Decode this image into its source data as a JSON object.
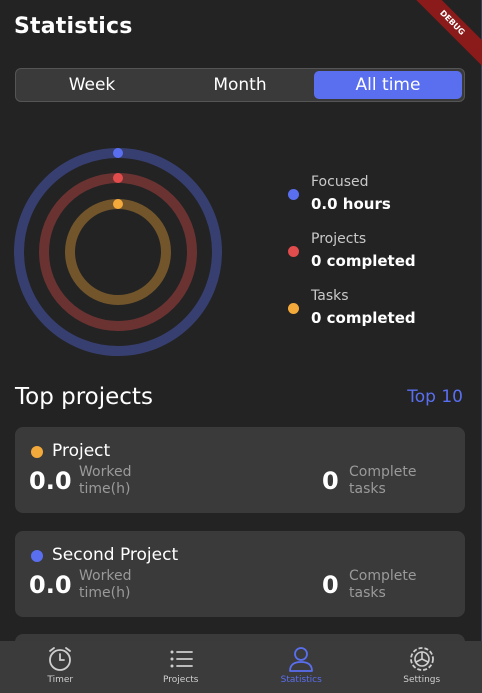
{
  "header": {
    "title": "Statistics",
    "debug_badge": "DEBUG"
  },
  "period_tabs": [
    {
      "label": "Week",
      "active": false
    },
    {
      "label": "Month",
      "active": false
    },
    {
      "label": "All time",
      "active": true
    }
  ],
  "rings": {
    "focused_color": "#5a6ff0",
    "projects_color": "#e14c4c",
    "tasks_color": "#f4a93b",
    "focused_progress": 0,
    "projects_progress": 0,
    "tasks_progress": 0
  },
  "legend": [
    {
      "label": "Focused",
      "value": "0.0 hours",
      "color": "#5a6ff0"
    },
    {
      "label": "Projects",
      "value": "0 completed",
      "color": "#e14c4c"
    },
    {
      "label": "Tasks",
      "value": "0 completed",
      "color": "#f4a93b"
    }
  ],
  "top_projects": {
    "title": "Top projects",
    "link": "Top 10",
    "items": [
      {
        "name": "Project",
        "color": "#f4a93b",
        "hours": "0.0",
        "hours_label": "Worked time(h)",
        "tasks": "0",
        "tasks_label": "Complete tasks"
      },
      {
        "name": "Second Project",
        "color": "#5a6ff0",
        "hours": "0.0",
        "hours_label": "Worked time(h)",
        "tasks": "0",
        "tasks_label": "Complete tasks"
      }
    ]
  },
  "bottom_nav": [
    {
      "label": "Timer",
      "icon": "alarm-clock-icon",
      "active": false
    },
    {
      "label": "Projects",
      "icon": "list-icon",
      "active": false
    },
    {
      "label": "Statistics",
      "icon": "person-icon",
      "active": true
    },
    {
      "label": "Settings",
      "icon": "gear-icon",
      "active": false
    }
  ],
  "colors": {
    "accent": "#5a6ff0",
    "background": "#232323",
    "card": "#3a3a3a"
  }
}
